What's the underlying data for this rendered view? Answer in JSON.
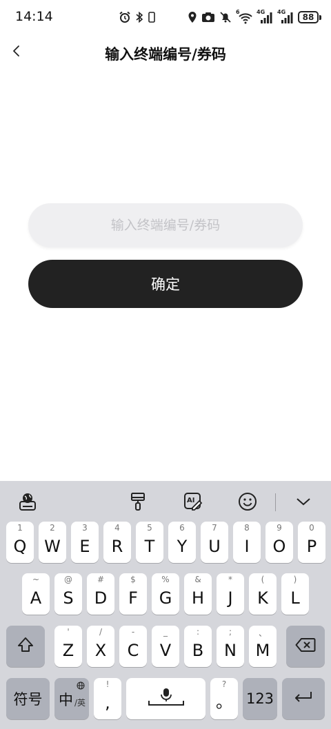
{
  "status_bar": {
    "time": "14:14",
    "battery": "88",
    "network_label": "4G",
    "wifi_label": "6"
  },
  "header": {
    "title": "输入终端编号/券码"
  },
  "form": {
    "input_placeholder": "输入终端编号/券码",
    "input_value": "",
    "confirm_label": "确定"
  },
  "colors": {
    "button_bg": "#222222",
    "input_bg": "#efeff1",
    "keyboard_bg": "#d5d6db"
  },
  "keyboard": {
    "row1": [
      {
        "main": "Q",
        "sub": "1"
      },
      {
        "main": "W",
        "sub": "2"
      },
      {
        "main": "E",
        "sub": "3"
      },
      {
        "main": "R",
        "sub": "4"
      },
      {
        "main": "T",
        "sub": "5"
      },
      {
        "main": "Y",
        "sub": "6"
      },
      {
        "main": "U",
        "sub": "7"
      },
      {
        "main": "I",
        "sub": "8"
      },
      {
        "main": "O",
        "sub": "9"
      },
      {
        "main": "P",
        "sub": "0"
      }
    ],
    "row2": [
      {
        "main": "A",
        "sub": "~"
      },
      {
        "main": "S",
        "sub": "@"
      },
      {
        "main": "D",
        "sub": "#"
      },
      {
        "main": "F",
        "sub": "$"
      },
      {
        "main": "G",
        "sub": "%"
      },
      {
        "main": "H",
        "sub": "&"
      },
      {
        "main": "J",
        "sub": "*"
      },
      {
        "main": "K",
        "sub": "("
      },
      {
        "main": "L",
        "sub": ")"
      }
    ],
    "row3": [
      {
        "main": "Z",
        "sub": "'"
      },
      {
        "main": "X",
        "sub": "/"
      },
      {
        "main": "C",
        "sub": "-"
      },
      {
        "main": "V",
        "sub": "_"
      },
      {
        "main": "B",
        "sub": ":"
      },
      {
        "main": "N",
        "sub": ";"
      },
      {
        "main": "M",
        "sub": "、"
      }
    ],
    "symbols_label": "符号",
    "lang_main": "中",
    "lang_sub": "/英",
    "comma_main": ",",
    "comma_sub": "!",
    "period_main": "。",
    "period_sub": "?",
    "numbers_label": "123"
  }
}
